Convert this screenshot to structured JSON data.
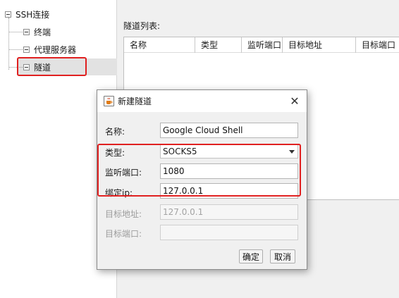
{
  "tree": {
    "root_label": "SSH连接",
    "items": [
      {
        "label": "终端"
      },
      {
        "label": "代理服务器"
      },
      {
        "label": "隧道"
      }
    ]
  },
  "tunnel_list": {
    "title": "隧道列表:",
    "columns": [
      "名称",
      "类型",
      "监听端口",
      "目标地址",
      "目标端口"
    ],
    "rows": []
  },
  "dialog": {
    "title": "新建隧道",
    "close_glyph": "✕",
    "fields": {
      "name": {
        "label": "名称:",
        "value": "Google Cloud Shell"
      },
      "type": {
        "label": "类型:",
        "value": "SOCKS5"
      },
      "listen_port": {
        "label": "监听端口:",
        "value": "1080"
      },
      "bind_ip": {
        "label": "绑定ip:",
        "value": "127.0.0.1"
      },
      "target_addr": {
        "label": "目标地址:",
        "value": "127.0.0.1",
        "disabled": true
      },
      "target_port": {
        "label": "目标端口:",
        "value": "",
        "disabled": true
      }
    },
    "ok_label": "确定",
    "cancel_label": "取消"
  },
  "colors": {
    "highlight_red": "#e02020",
    "selected_bg": "#e2e2e2",
    "window_bg": "#f0f0f0"
  },
  "icons": {
    "dialog_icon": "java-coffee-icon",
    "expander": "collapse-minus-icon",
    "close": "close-icon",
    "dropdown": "chevron-down-icon"
  }
}
